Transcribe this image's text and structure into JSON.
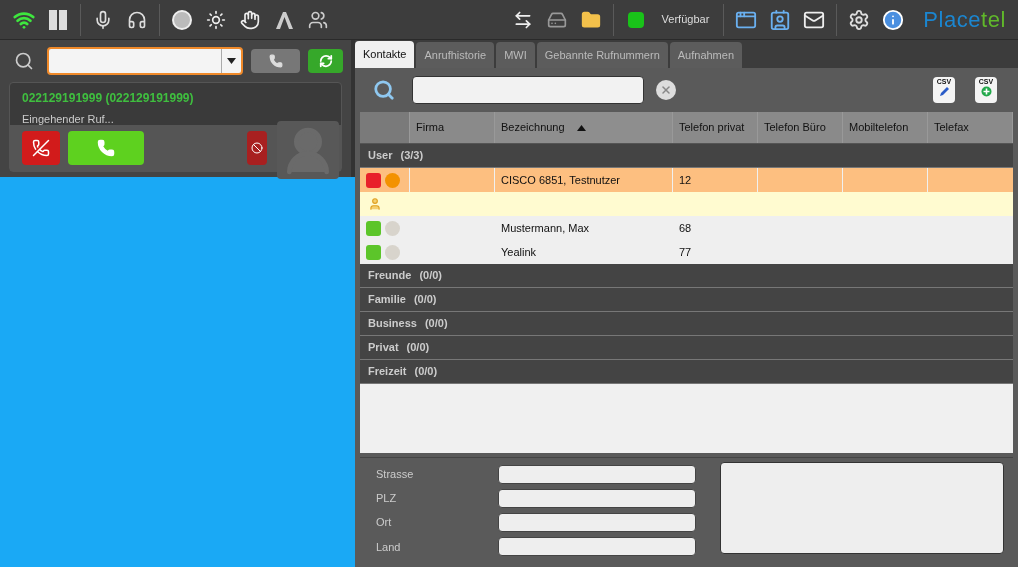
{
  "status": {
    "label": "Verfügbar",
    "color": "#19c219"
  },
  "logo": {
    "part_1": "Place",
    "part_2": "tel"
  },
  "call": {
    "caller": "022129191999 (**022129191999**)",
    "state": "Eingehender Ruf..."
  },
  "tabs": [
    {
      "label": "Kontakte",
      "selected": true
    },
    {
      "label": "Anrufhistorie",
      "selected": false
    },
    {
      "label": "MWI",
      "selected": false
    },
    {
      "label": "Gebannte Rufnummern",
      "selected": false
    },
    {
      "label": "Aufnahmen",
      "selected": false
    }
  ],
  "csv_buttons": [
    {
      "label": "CSV",
      "kind": "edit"
    },
    {
      "label": "CSV",
      "kind": "add"
    }
  ],
  "table": {
    "columns": [
      {
        "label": "Firma",
        "sorted": false
      },
      {
        "label": "Bezeichnung",
        "sorted": true
      },
      {
        "label": "Telefon privat",
        "sorted": false
      },
      {
        "label": "Telefon Büro",
        "sorted": false
      },
      {
        "label": "Mobiltelefon",
        "sorted": false
      },
      {
        "label": "Telefax",
        "sorted": false
      }
    ],
    "groups": [
      {
        "label": "User",
        "count": "(3/3)",
        "rows": [
          {
            "kind": "contact",
            "selected": true,
            "presence": {
              "color": "#e8202a"
            },
            "phone": {
              "color": "#f39200"
            },
            "bezeichnung": "CISCO 6851, Testnutzer",
            "telefon_privat": "12"
          },
          {
            "kind": "detail",
            "selected": false
          },
          {
            "kind": "contact",
            "selected": false,
            "presence": {
              "color": "#5cc52a"
            },
            "phone": {
              "color": "#d8d4cc"
            },
            "bezeichnung": "Mustermann, Max",
            "telefon_privat": "68"
          },
          {
            "kind": "contact",
            "selected": false,
            "presence": {
              "color": "#5cc52a"
            },
            "phone": {
              "color": "#d8d4cc"
            },
            "bezeichnung": "Yealink",
            "telefon_privat": "77"
          }
        ]
      },
      {
        "label": "Freunde",
        "count": "(0/0)"
      },
      {
        "label": "Familie",
        "count": "(0/0)"
      },
      {
        "label": "Business",
        "count": "(0/0)"
      },
      {
        "label": "Privat",
        "count": "(0/0)"
      },
      {
        "label": "Freizeit",
        "count": "(0/0)"
      }
    ]
  },
  "address": [
    {
      "label": "Strasse"
    },
    {
      "label": "PLZ"
    },
    {
      "label": "Ort"
    },
    {
      "label": "Land"
    }
  ]
}
